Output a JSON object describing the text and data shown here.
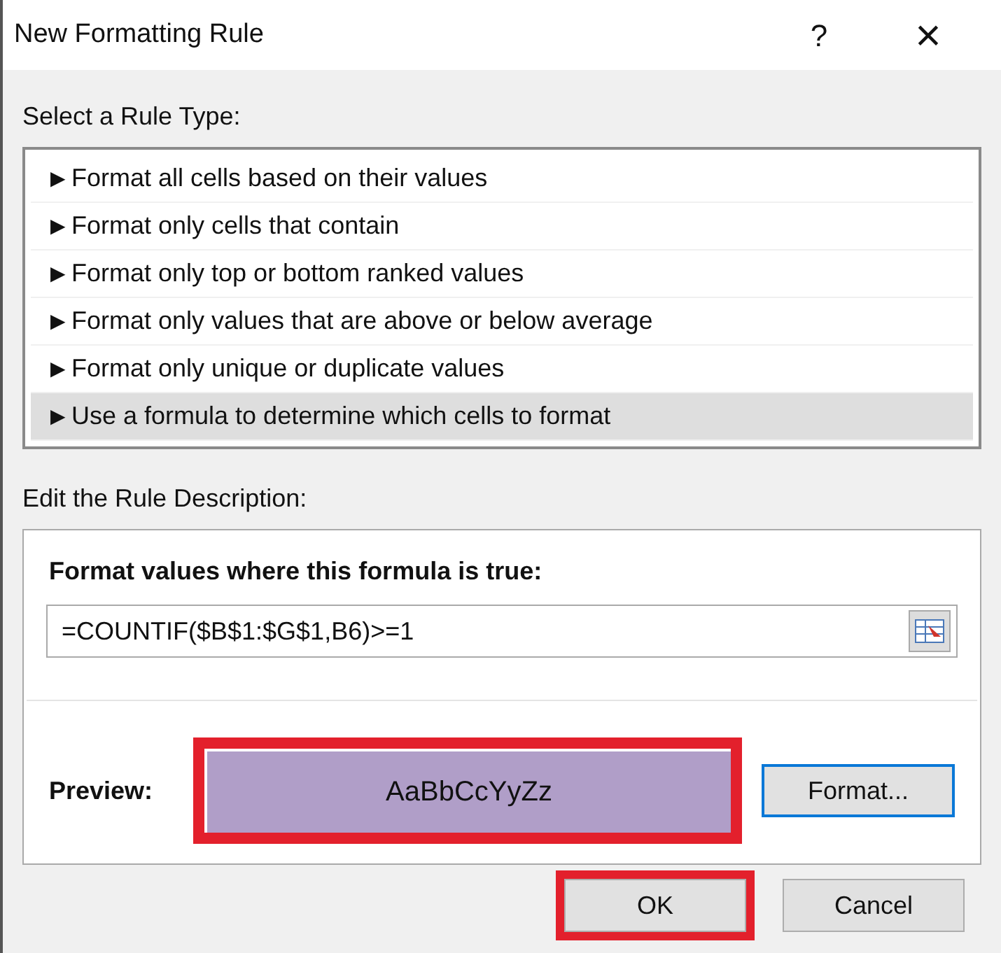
{
  "window": {
    "title": "New Formatting Rule",
    "help": "?",
    "close": "×"
  },
  "rule_type": {
    "label": "Select a Rule Type:",
    "items": [
      {
        "arrow": "▶",
        "label": "Format all cells based on their values",
        "selected": false
      },
      {
        "arrow": "▶",
        "label": "Format only cells that contain",
        "selected": false
      },
      {
        "arrow": "▶",
        "label": "Format only top or bottom ranked values",
        "selected": false
      },
      {
        "arrow": "▶",
        "label": "Format only values that are above or below average",
        "selected": false
      },
      {
        "arrow": "▶",
        "label": "Format only unique or duplicate values",
        "selected": false
      },
      {
        "arrow": "▶",
        "label": "Use a formula to determine which cells to format",
        "selected": true
      }
    ]
  },
  "description": {
    "label": "Edit the Rule Description:",
    "heading": "Format values where this formula is true:",
    "formula": "=COUNTIF($B$1:$G$1,B6)>=1",
    "preview": {
      "label": "Preview:",
      "sample": "AaBbCcYyZz",
      "highlighted": true
    },
    "format_button": {
      "label": "Format...",
      "focused": true
    }
  },
  "buttons": [
    {
      "label": "OK",
      "highlighted": true
    },
    {
      "label": "Cancel",
      "highlighted": false
    }
  ]
}
